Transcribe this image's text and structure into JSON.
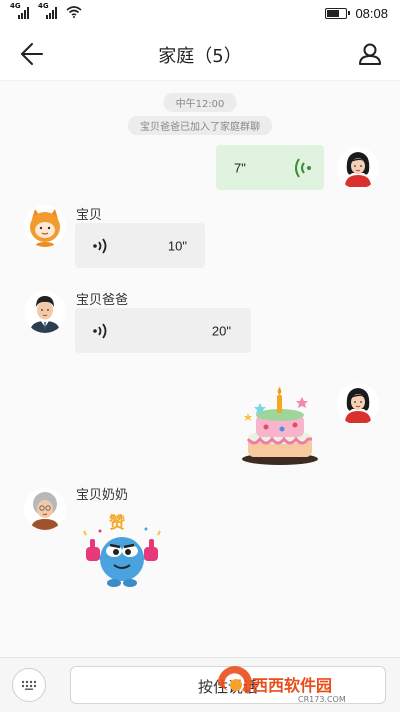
{
  "status_bar": {
    "time": "08:08",
    "signal1_tag": "4G",
    "signal2_tag": "4G",
    "battery_level": 0.75
  },
  "header": {
    "title": "家庭（5）"
  },
  "chat": {
    "time_pill": "中午12:00",
    "system_notice": "宝贝爸爸已加入了家庭群聊",
    "messages": [
      {
        "sender": "",
        "side": "right",
        "type": "voice",
        "duration": "7\""
      },
      {
        "sender": "宝贝",
        "side": "left",
        "type": "voice",
        "duration": "10\""
      },
      {
        "sender": "宝贝爸爸",
        "side": "left",
        "type": "voice",
        "duration": "20\""
      },
      {
        "sender": "",
        "side": "right",
        "type": "sticker",
        "sticker": "birthday-cake"
      },
      {
        "sender": "宝贝奶奶",
        "side": "left",
        "type": "sticker",
        "sticker": "thumbs-up-monster",
        "sticker_text": "赞"
      }
    ]
  },
  "input_bar": {
    "hold_to_talk_label": "按住说话"
  },
  "watermark": {
    "text": "西西软件园",
    "url_text": "CR173.COM"
  },
  "colors": {
    "outgoing_bubble": "#dff3de",
    "incoming_bubble": "#efefef",
    "voice_wave_out": "#3a8a3a"
  }
}
